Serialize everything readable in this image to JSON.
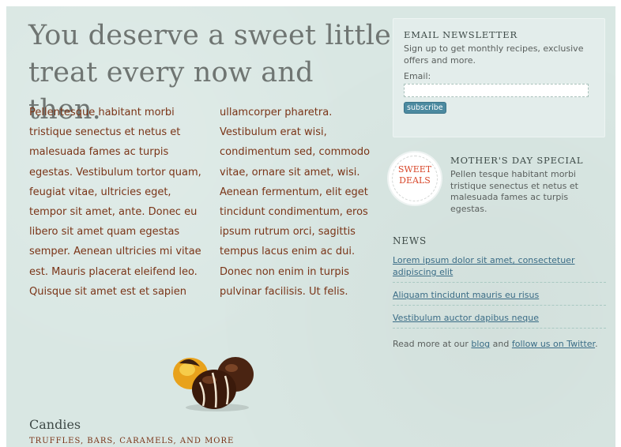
{
  "main": {
    "headline": "You deserve a sweet little treat every now and then.",
    "col1": "Pellentesque habitant morbi tristique senectus et netus et malesuada fames ac turpis egestas. Vestibulum tortor quam, feugiat vitae, ultricies eget, tempor sit amet, ante. Donec eu libero sit amet quam egestas semper. Aenean ultricies mi vitae est. Mauris placerat eleifend leo. Quisque sit amet est et sapien",
    "col2": "ullamcorper pharetra. Vestibulum erat wisi, condimentum sed, commodo vitae, ornare sit amet, wisi. Aenean fermentum, elit eget tincidunt condimentum, eros ipsum rutrum orci, sagittis tempus lacus enim ac dui. Donec non enim in turpis pulvinar facilisis. Ut felis."
  },
  "candies": {
    "title": "Candies",
    "subtitle": "TRUFFLES, BARS, CARAMELS, AND MORE"
  },
  "newsletter": {
    "title": "EMAIL NEWSLETTER",
    "description": "Sign up to get monthly recipes, exclusive offers and more.",
    "email_label": "Email:",
    "email_value": "",
    "email_placeholder": "",
    "button_label": "subscribe"
  },
  "special": {
    "badge_line1": "SWEET",
    "badge_line2": "DEALS",
    "title": "MOTHER'S DAY SPECIAL",
    "description": "Pellen tesque habitant morbi tristique senectus et netus et malesuada fames ac turpis egestas."
  },
  "news": {
    "title": "NEWS",
    "items": [
      "Lorem ipsum dolor sit amet, consectetuer adipiscing elit",
      "Aliquam tincidunt mauris eu risus",
      "Vestibulum auctor dapibus neque"
    ],
    "readmore_prefix": "Read more at our ",
    "blog_link": "blog",
    "readmore_and": " and ",
    "twitter_link": "follow us on Twitter",
    "readmore_suffix": "."
  },
  "colors": {
    "background": "#d9e7e3",
    "body_text": "#7a3417",
    "link": "#3a6c86",
    "badge_text": "#d8472a",
    "button": "#4c8aa0"
  }
}
